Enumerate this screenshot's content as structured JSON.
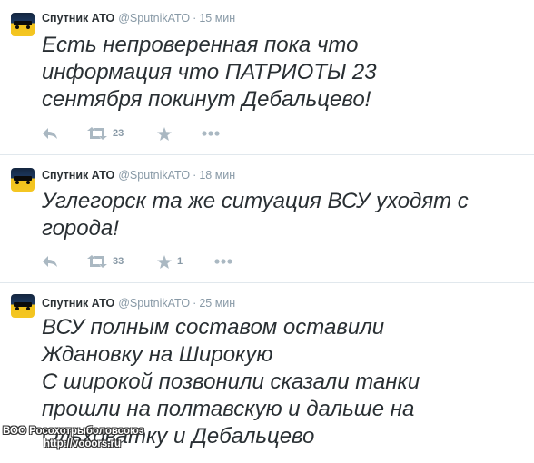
{
  "tweets": [
    {
      "name": "Спутник АТО",
      "handle": "@SputnikATO",
      "separator": "·",
      "time": "15 мин",
      "text": "Есть непроверенная пока что\nинформация что ПАТРИОТЫ 23\nсентября покинут Дебальцево!",
      "retweets": "23",
      "favorites": ""
    },
    {
      "name": "Спутник АТО",
      "handle": "@SputnikATO",
      "separator": "·",
      "time": "18 мин",
      "text": "Углегорск та же ситуация ВСУ уходят с\nгорода!",
      "retweets": "33",
      "favorites": "1"
    },
    {
      "name": "Спутник АТО",
      "handle": "@SputnikATO",
      "separator": "·",
      "time": "25 мин",
      "text": "ВСУ полным составом оставили\nЖдановку на Широкую\nС широкой позвонили сказали танки\nпрошли на полтавскую и дальше на\nОльховатку и Дебальцево",
      "retweets": "",
      "favorites": ""
    }
  ],
  "watermark": {
    "line1": "ВОО Росохотрыболовсоюз",
    "line2": "http://vooors.ru"
  },
  "colors": {
    "icon": "#aab8c2",
    "meta": "#8899a6",
    "text": "#292f33",
    "divider": "#e1e8ed"
  },
  "icons": [
    "reply-icon",
    "retweet-icon",
    "favorite-star-icon",
    "more-dots-icon"
  ]
}
